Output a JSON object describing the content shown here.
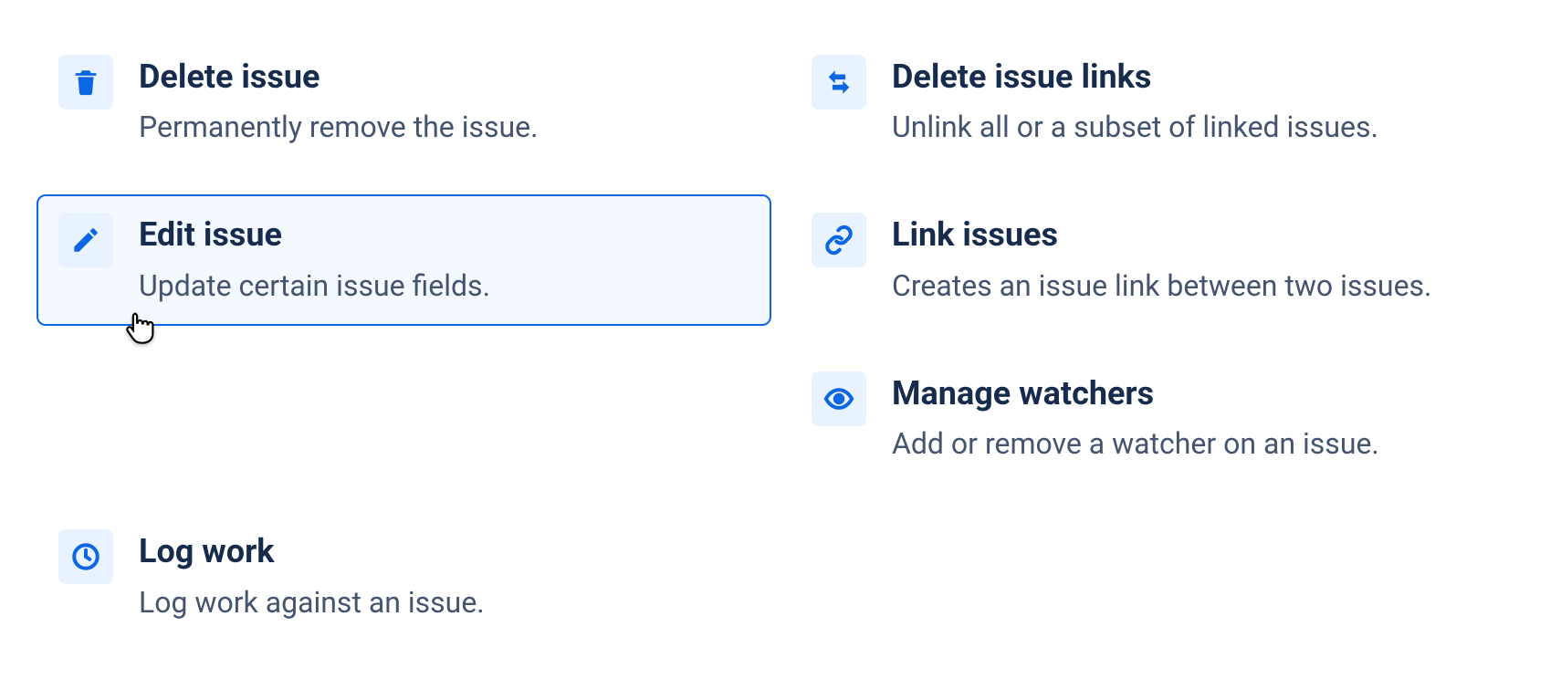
{
  "actions": {
    "delete_issue": {
      "title": "Delete issue",
      "desc": "Permanently remove the issue."
    },
    "edit_issue": {
      "title": "Edit issue",
      "desc": "Update certain issue fields."
    },
    "log_work": {
      "title": "Log work",
      "desc": "Log work against an issue."
    },
    "delete_issue_links": {
      "title": "Delete issue links",
      "desc": "Unlink all or a subset of linked issues."
    },
    "link_issues": {
      "title": "Link issues",
      "desc": "Creates an issue link between two issues."
    },
    "manage_watchers": {
      "title": "Manage watchers",
      "desc": "Add or remove a watcher on an issue."
    }
  }
}
